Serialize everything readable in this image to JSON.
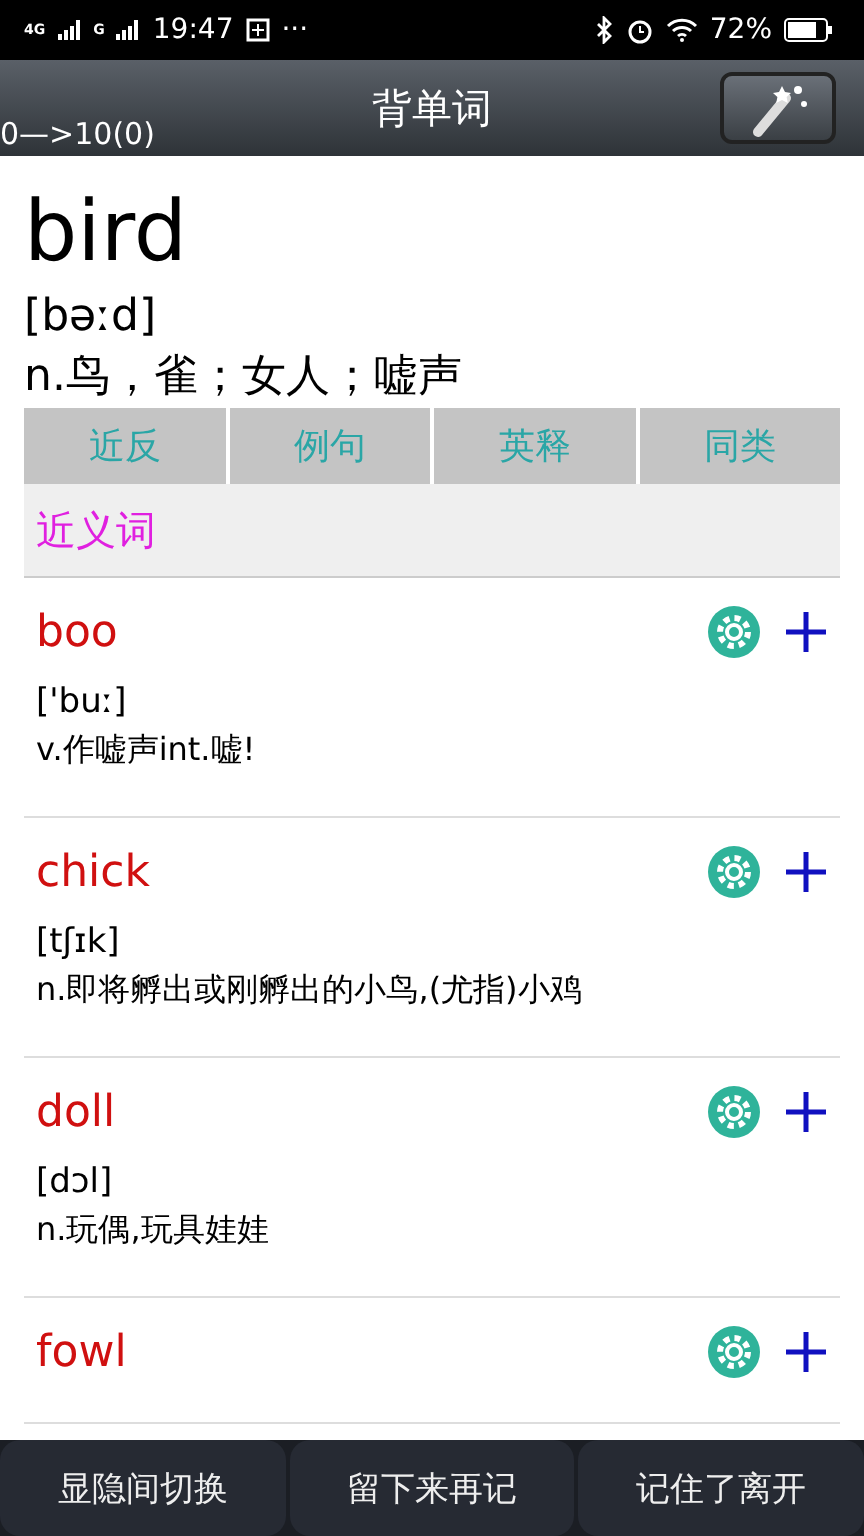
{
  "status_bar": {
    "network_1": "4G",
    "network_2": "G",
    "time": "19:47",
    "more": "···",
    "battery": "72%"
  },
  "header": {
    "title": "背单词",
    "progress": "0—>10(0)"
  },
  "word": {
    "headword": "bird",
    "phonetic": "[bəːd]",
    "meaning": "n.鸟，雀；女人；嘘声"
  },
  "tabs": [
    {
      "label": "近反"
    },
    {
      "label": "例句"
    },
    {
      "label": "英释"
    },
    {
      "label": "同类"
    }
  ],
  "section_title": "近义词",
  "entries": [
    {
      "word": "boo",
      "phonetic": "['buː]",
      "meaning": "v.作嘘声int.嘘!"
    },
    {
      "word": "chick",
      "phonetic": "[tʃɪk]",
      "meaning": "n.即将孵出或刚孵出的小鸟,(尤指)小鸡"
    },
    {
      "word": "doll",
      "phonetic": "[dɔl]",
      "meaning": "n.玩偶,玩具娃娃"
    },
    {
      "word": "fowl"
    }
  ],
  "bottom_buttons": [
    "显隐间切换",
    "留下来再记",
    "记住了离开"
  ]
}
